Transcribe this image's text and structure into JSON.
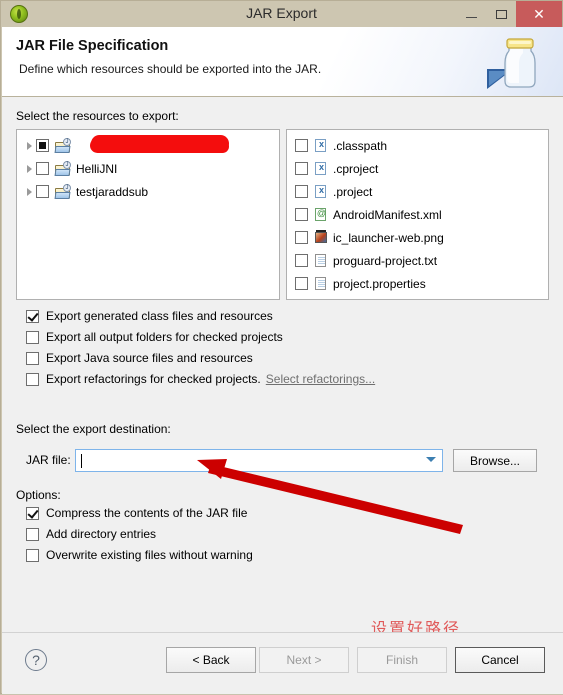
{
  "window": {
    "title": "JAR Export",
    "app_icon": "eclipse-icon",
    "controls": {
      "minimize": "minimize-icon",
      "maximize": "maximize-icon",
      "close": "✕"
    }
  },
  "header": {
    "title": "JAR File Specification",
    "subtitle": "Define which resources should be exported into the JAR.",
    "banner_icon": "jar-icon"
  },
  "resources": {
    "label": "Select the resources to export:",
    "tree": [
      {
        "label": "",
        "redacted": true,
        "checkbox": "partial",
        "icon": "java-project-icon"
      },
      {
        "label": "HelliJNI",
        "redacted": false,
        "checkbox": "unchecked",
        "icon": "java-project-icon"
      },
      {
        "label": "testjaraddsub",
        "redacted": false,
        "checkbox": "unchecked",
        "icon": "java-project-icon"
      }
    ],
    "files": [
      {
        "label": ".classpath",
        "checkbox": "unchecked",
        "icon": "xml-file-icon"
      },
      {
        "label": ".cproject",
        "checkbox": "unchecked",
        "icon": "xml-file-icon"
      },
      {
        "label": ".project",
        "checkbox": "unchecked",
        "icon": "xml-file-icon"
      },
      {
        "label": "AndroidManifest.xml",
        "checkbox": "unchecked",
        "icon": "manifest-file-icon"
      },
      {
        "label": "ic_launcher-web.png",
        "checkbox": "unchecked",
        "icon": "image-file-icon"
      },
      {
        "label": "proguard-project.txt",
        "checkbox": "unchecked",
        "icon": "text-file-icon"
      },
      {
        "label": "project.properties",
        "checkbox": "unchecked",
        "icon": "text-file-icon"
      }
    ]
  },
  "export_options": [
    {
      "label": "Export generated class files and resources",
      "checked": true
    },
    {
      "label": "Export all output folders for checked projects",
      "checked": false
    },
    {
      "label": "Export Java source files and resources",
      "checked": false
    },
    {
      "label": "Export refactorings for checked projects.",
      "checked": false,
      "link": "Select refactorings..."
    }
  ],
  "destination": {
    "label": "Select the export destination:",
    "field_label": "JAR file:",
    "value": "",
    "placeholder": "",
    "dropdown_icon": "chevron-down-icon",
    "browse_label": "Browse..."
  },
  "options": {
    "label": "Options:",
    "items": [
      {
        "label": "Compress the contents of the JAR file",
        "checked": true
      },
      {
        "label": "Add directory entries",
        "checked": false
      },
      {
        "label": "Overwrite existing files without warning",
        "checked": false
      }
    ]
  },
  "annotation": {
    "text": "设置好路径",
    "color": "#e05a5a",
    "arrow_color": "#cc0000"
  },
  "footer": {
    "help_icon": "?",
    "buttons": [
      {
        "id": "back",
        "label": "< Back",
        "enabled": true
      },
      {
        "id": "next",
        "label": "Next >",
        "enabled": false
      },
      {
        "id": "finish",
        "label": "Finish",
        "enabled": false
      },
      {
        "id": "cancel",
        "label": "Cancel",
        "enabled": true
      }
    ]
  }
}
